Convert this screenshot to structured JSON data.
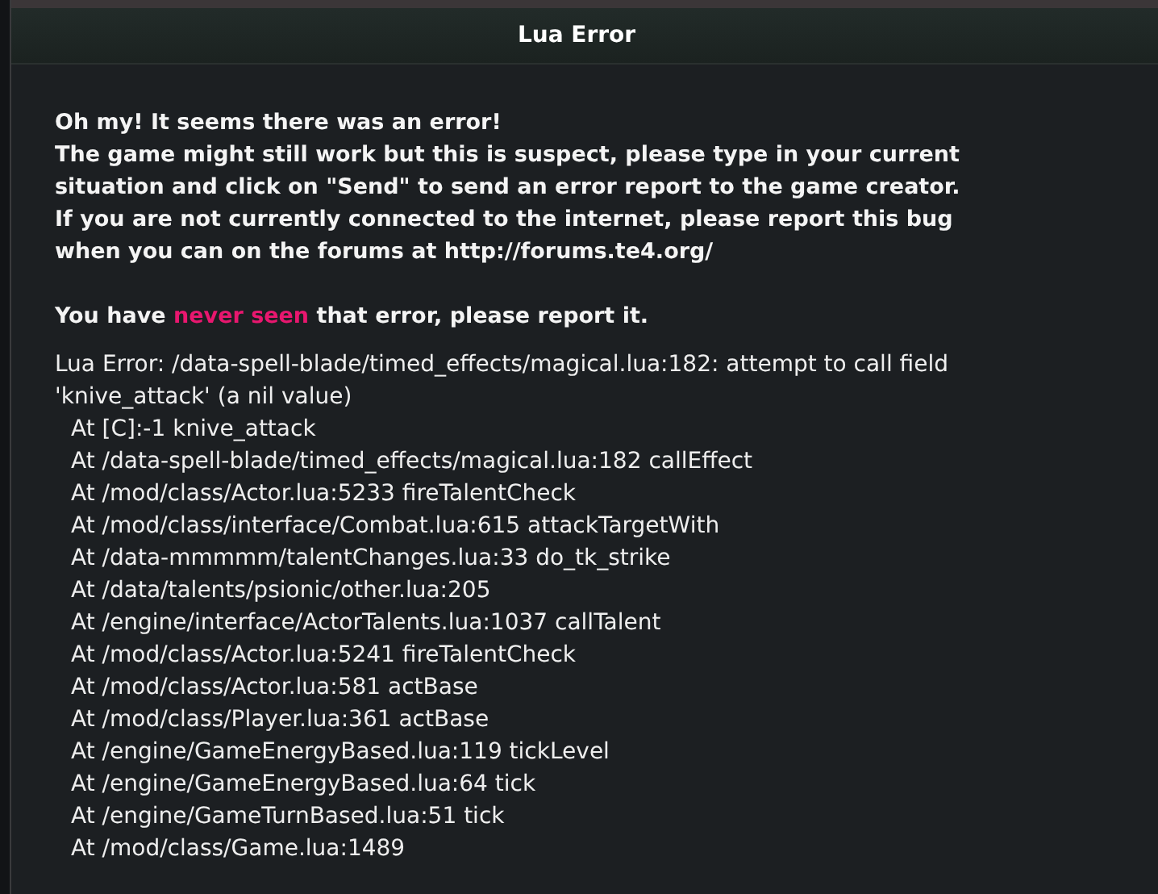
{
  "window": {
    "title": "Lua Error"
  },
  "message_lines": [
    "Oh my! It seems there was an error!",
    "The game might still work but this is suspect, please type in your current",
    "situation and click on \"Send\" to send an error report to the game creator.",
    "If you are not currently connected to the internet, please report this bug",
    "when you can on the forums at http://forums.te4.org/"
  ],
  "notice": {
    "before": "You have ",
    "highlight": "never seen",
    "after": " that error, please report it."
  },
  "error_lines": [
    "Lua Error: /data-spell-blade/timed_effects/magical.lua:182: attempt to call field",
    "'knive_attack' (a nil value)"
  ],
  "traceback": [
    "At [C]:-1 knive_attack",
    "At /data-spell-blade/timed_effects/magical.lua:182 callEffect",
    "At /mod/class/Actor.lua:5233 fireTalentCheck",
    "At /mod/class/interface/Combat.lua:615 attackTargetWith",
    "At /data-mmmmm/talentChanges.lua:33 do_tk_strike",
    "At /data/talents/psionic/other.lua:205",
    "At /engine/interface/ActorTalents.lua:1037 callTalent",
    "At /mod/class/Actor.lua:5241 fireTalentCheck",
    "At /mod/class/Actor.lua:581 actBase",
    "At /mod/class/Player.lua:361 actBase",
    "At /engine/GameEnergyBased.lua:119 tickLevel",
    "At /engine/GameEnergyBased.lua:64 tick",
    "At /engine/GameTurnBased.lua:51 tick",
    "At /mod/class/Game.lua:1489"
  ]
}
